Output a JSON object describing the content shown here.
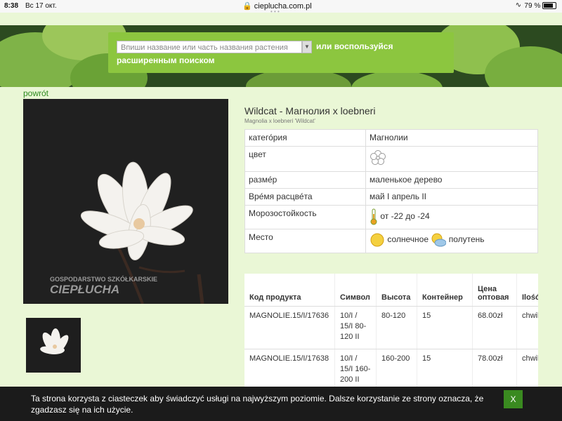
{
  "statusbar": {
    "time": "8:38",
    "date": "Вс 17 окт.",
    "url": "cieplucha.com.pl",
    "battery": "79 %"
  },
  "search": {
    "placeholder": "Впиши название или часть названия растения",
    "text1": "или воспользуйся",
    "text2": "расширенным поиском"
  },
  "back_link": "powrót",
  "photo": {
    "watermark_line1": "GOSPODARSTWO SZKÓŁKARSKIE",
    "watermark_line2": "CIEPŁUCHA"
  },
  "product": {
    "title": "Wildcat - Магнолия x loebneri",
    "subtitle": "Magnolia x loebneri 'Wildcat'"
  },
  "attributes": [
    {
      "key": "катего́рия",
      "value": "Магнолии"
    },
    {
      "key": "цвет",
      "value": "",
      "icon": "white-flower-icon"
    },
    {
      "key": "разме́р",
      "value": "маленькое дерево"
    },
    {
      "key": "Вре́мя расцве́та",
      "value": "май I апрель II"
    },
    {
      "key": "Морозостойкость",
      "value": "от -22 до -24",
      "icon": "thermometer-icon"
    },
    {
      "key": "Место",
      "value_sun": "солнечное",
      "value_partial": "полутень"
    }
  ],
  "table": {
    "headers": [
      "Код продукта",
      "Символ",
      "Высота",
      "Контейнер",
      "Цена оптовая",
      "Ilość"
    ],
    "rows": [
      {
        "code": "MAGNOLIE.15/I/17636",
        "symbol": "10/I / 15/I 80-120 II",
        "height": "80-120",
        "container": "15",
        "price": "68.00zł",
        "qty": "chwilo brak"
      },
      {
        "code": "MAGNOLIE.15/I/17638",
        "symbol": "10/I / 15/I 160-200 II",
        "height": "160-200",
        "container": "15",
        "price": "78.00zł",
        "qty": "chwilo brak"
      }
    ]
  },
  "cookie": {
    "text": "Ta strona korzysta z ciasteczek aby świadczyć usługi na najwyższym poziomie. Dalsze korzystanie ze strony oznacza, że zgadzasz się na ich użycie.",
    "button": "X"
  }
}
